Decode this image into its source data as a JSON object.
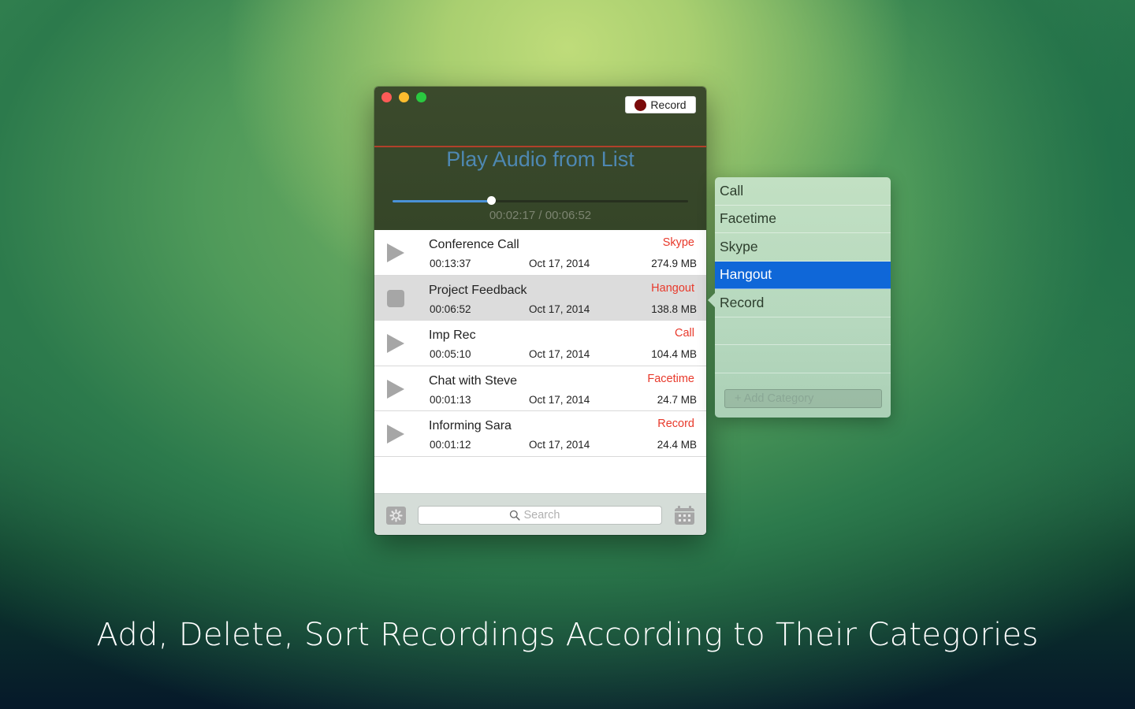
{
  "window": {
    "record_button_label": "Record",
    "now_playing_title": "Play Audio from List",
    "playback": {
      "elapsed": "00:02:17",
      "total": "00:06:52",
      "separator": " / ",
      "progress_fraction": 0.333
    }
  },
  "recordings": [
    {
      "title": "Conference Call",
      "duration": "00:13:37",
      "date": "Oct 17, 2014",
      "category": "Skype",
      "size": "274.9 MB",
      "state": "play",
      "selected": false
    },
    {
      "title": "Project Feedback",
      "duration": "00:06:52",
      "date": "Oct 17, 2014",
      "category": "Hangout",
      "size": "138.8 MB",
      "state": "stop",
      "selected": true
    },
    {
      "title": "Imp Rec",
      "duration": "00:05:10",
      "date": "Oct 17, 2014",
      "category": "Call",
      "size": "104.4 MB",
      "state": "play",
      "selected": false
    },
    {
      "title": "Chat with Steve",
      "duration": "00:01:13",
      "date": "Oct 17, 2014",
      "category": "Facetime",
      "size": "24.7 MB",
      "state": "play",
      "selected": false
    },
    {
      "title": "Informing Sara",
      "duration": "00:01:12",
      "date": "Oct 17, 2014",
      "category": "Record",
      "size": "24.4 MB",
      "state": "play",
      "selected": false
    }
  ],
  "bottombar": {
    "search_placeholder": "Search",
    "search_value": "",
    "settings_icon": "gear-icon",
    "calendar_icon": "calendar-icon"
  },
  "category_popover": {
    "items": [
      {
        "label": "Call",
        "active": false
      },
      {
        "label": "Facetime",
        "active": false
      },
      {
        "label": "Skype",
        "active": false
      },
      {
        "label": "Hangout",
        "active": true
      },
      {
        "label": "Record",
        "active": false
      }
    ],
    "empty_slots": 3,
    "add_button_label": "+ Add Category"
  },
  "caption": "Add, Delete, Sort Recordings According to Their Categories",
  "colors": {
    "accent_blue": "#0f67d8",
    "category_red": "#e8392b",
    "record_dot": "#7a0a0a",
    "progress_fill": "#4a92d8"
  }
}
